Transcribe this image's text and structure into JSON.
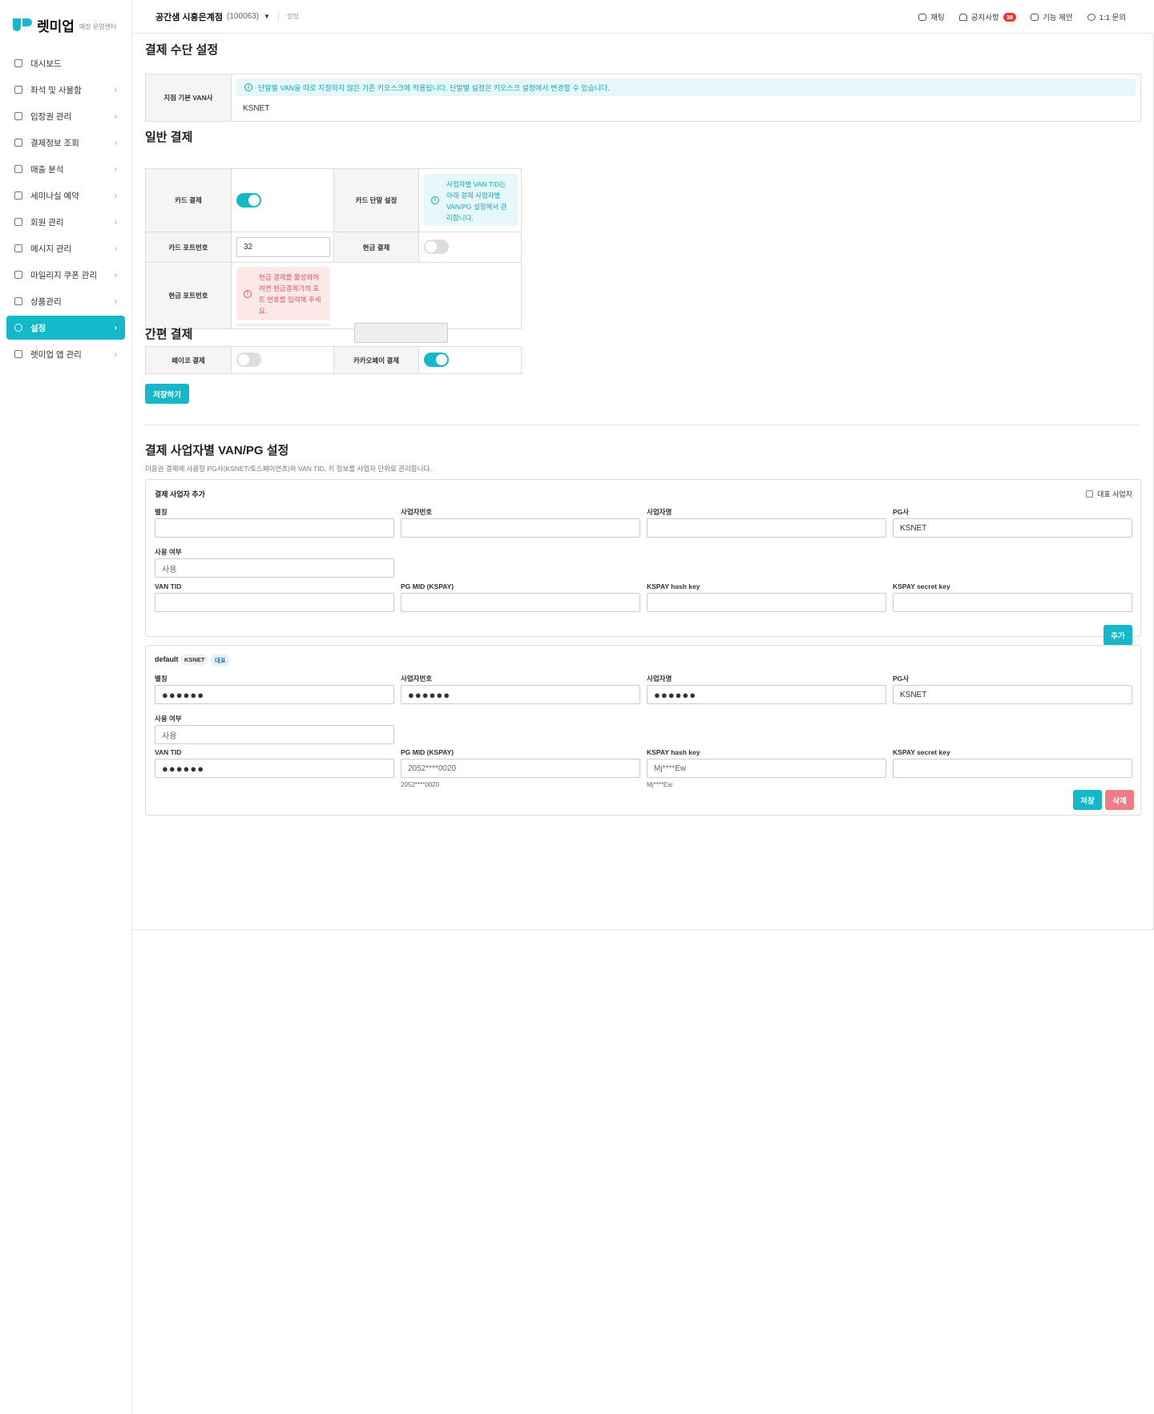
{
  "brand": {
    "name": "렛미업",
    "sub": "매장 운영센터"
  },
  "sidebar": {
    "items": [
      {
        "label": "대시보드",
        "icon": "dashboard-icon",
        "chevron": ""
      },
      {
        "label": "좌석 및 사물함",
        "icon": "seat-icon",
        "chevron": "›"
      },
      {
        "label": "입장권 관리",
        "icon": "ticket-icon",
        "chevron": "›"
      },
      {
        "label": "결제정보 조회",
        "icon": "card-icon",
        "chevron": "›"
      },
      {
        "label": "매출 분석",
        "icon": "chart-icon",
        "chevron": "›"
      },
      {
        "label": "세미나실 예약",
        "icon": "calendar-icon",
        "chevron": "›"
      },
      {
        "label": "회원 관리",
        "icon": "users-icon",
        "chevron": "›"
      },
      {
        "label": "메시지 관리",
        "icon": "mail-icon",
        "chevron": "›"
      },
      {
        "label": "마일리지 쿠폰 관리",
        "icon": "coupon-icon",
        "chevron": "›"
      },
      {
        "label": "상품관리",
        "icon": "product-icon",
        "chevron": "›"
      },
      {
        "label": "설정",
        "icon": "gear-icon",
        "chevron": "›",
        "active": true
      },
      {
        "label": "렛미업 앱 관리",
        "icon": "app-icon",
        "chevron": "›"
      }
    ]
  },
  "header": {
    "store_name": "공간샘 시흥은계점",
    "store_id": "(100063)",
    "breadcrumb": "설정",
    "links": {
      "chat": "채팅",
      "notice": "공지사항",
      "notice_badge": "38",
      "suggest": "기능 제안",
      "inquiry": "1:1 문의"
    }
  },
  "payment_method": {
    "title": "결제 수단 설정",
    "van_label": "지점 기본 VAN사",
    "van_info": "단말별 VAN을 따로 지정하지 않은 기존 키오스크에 적용됩니다. 단말별 설정은 키오스크 설정에서 변경할 수 있습니다.",
    "van_value": "KSNET"
  },
  "general": {
    "title": "일반 결제",
    "card_pay_label": "카드 결제",
    "card_pay_on": true,
    "card_terminal_label": "카드 단말 설정",
    "card_terminal_note": "사업자별 VAN TID는 아래 결제 사업자별 VAN/PG 설정에서 관리합니다.",
    "card_port_label": "카드 포트번호",
    "card_port_value": "32",
    "cash_pay_label": "현금 결제",
    "cash_pay_on": false,
    "cash_port_label": "현금 포트번호",
    "cash_port_note": "현금 결제를 활성화하려면 현금결제기의 포트 번호를 입력해 주세요.",
    "cash_port_value": ""
  },
  "easy": {
    "title": "간편 결제",
    "payco_label": "페이코 결제",
    "payco_on": false,
    "kakao_label": "카카오페이 결제",
    "kakao_on": true
  },
  "save_button": "저장하기",
  "business": {
    "title": "결제 사업자별 VAN/PG 설정",
    "desc": "이용권 결제에 사용할 PG사(KSNET/토스페이먼츠)와 VAN TID, 키 정보를 사업자 단위로 관리합니다.",
    "add_card": {
      "title": "결제 사업자 추가",
      "rep_label": "대표 사업자",
      "labels": {
        "alias": "별칭",
        "biz_no": "사업자번호",
        "biz_name": "사업자명",
        "pg": "PG사",
        "use": "사용 여부",
        "van_tid": "VAN TID",
        "pg_mid": "PG MID (KSPAY)",
        "hash_key": "KSPAY hash key",
        "secret_key": "KSPAY secret key"
      },
      "values": {
        "alias": "",
        "biz_no": "",
        "biz_name": "",
        "pg": "KSNET",
        "use": "사용",
        "van_tid": "",
        "pg_mid": "",
        "hash_key": "",
        "secret_key": ""
      },
      "add_button": "추가"
    },
    "entry": {
      "name": "default",
      "tag_pg": "KSNET",
      "tag_rep": "대표",
      "labels": {
        "alias": "별칭",
        "biz_no": "사업자번호",
        "biz_name": "사업자명",
        "pg": "PG사",
        "use": "사용 여부",
        "van_tid": "VAN TID",
        "pg_mid": "PG MID (KSPAY)",
        "hash_key": "KSPAY hash key",
        "secret_key": "KSPAY secret key"
      },
      "values": {
        "alias": "●●●●●●",
        "biz_no": "●●●●●●",
        "biz_name": "●●●●●●",
        "pg": "KSNET",
        "use": "사용",
        "van_tid": "●●●●●●",
        "pg_mid": "2052****0020",
        "hash_key": "Mj****Ew",
        "secret_key": ""
      },
      "hints": {
        "pg_mid": "2052****0020",
        "hash_key": "Mj****Ew"
      },
      "save_button": "저장",
      "delete_button": "삭제"
    }
  }
}
